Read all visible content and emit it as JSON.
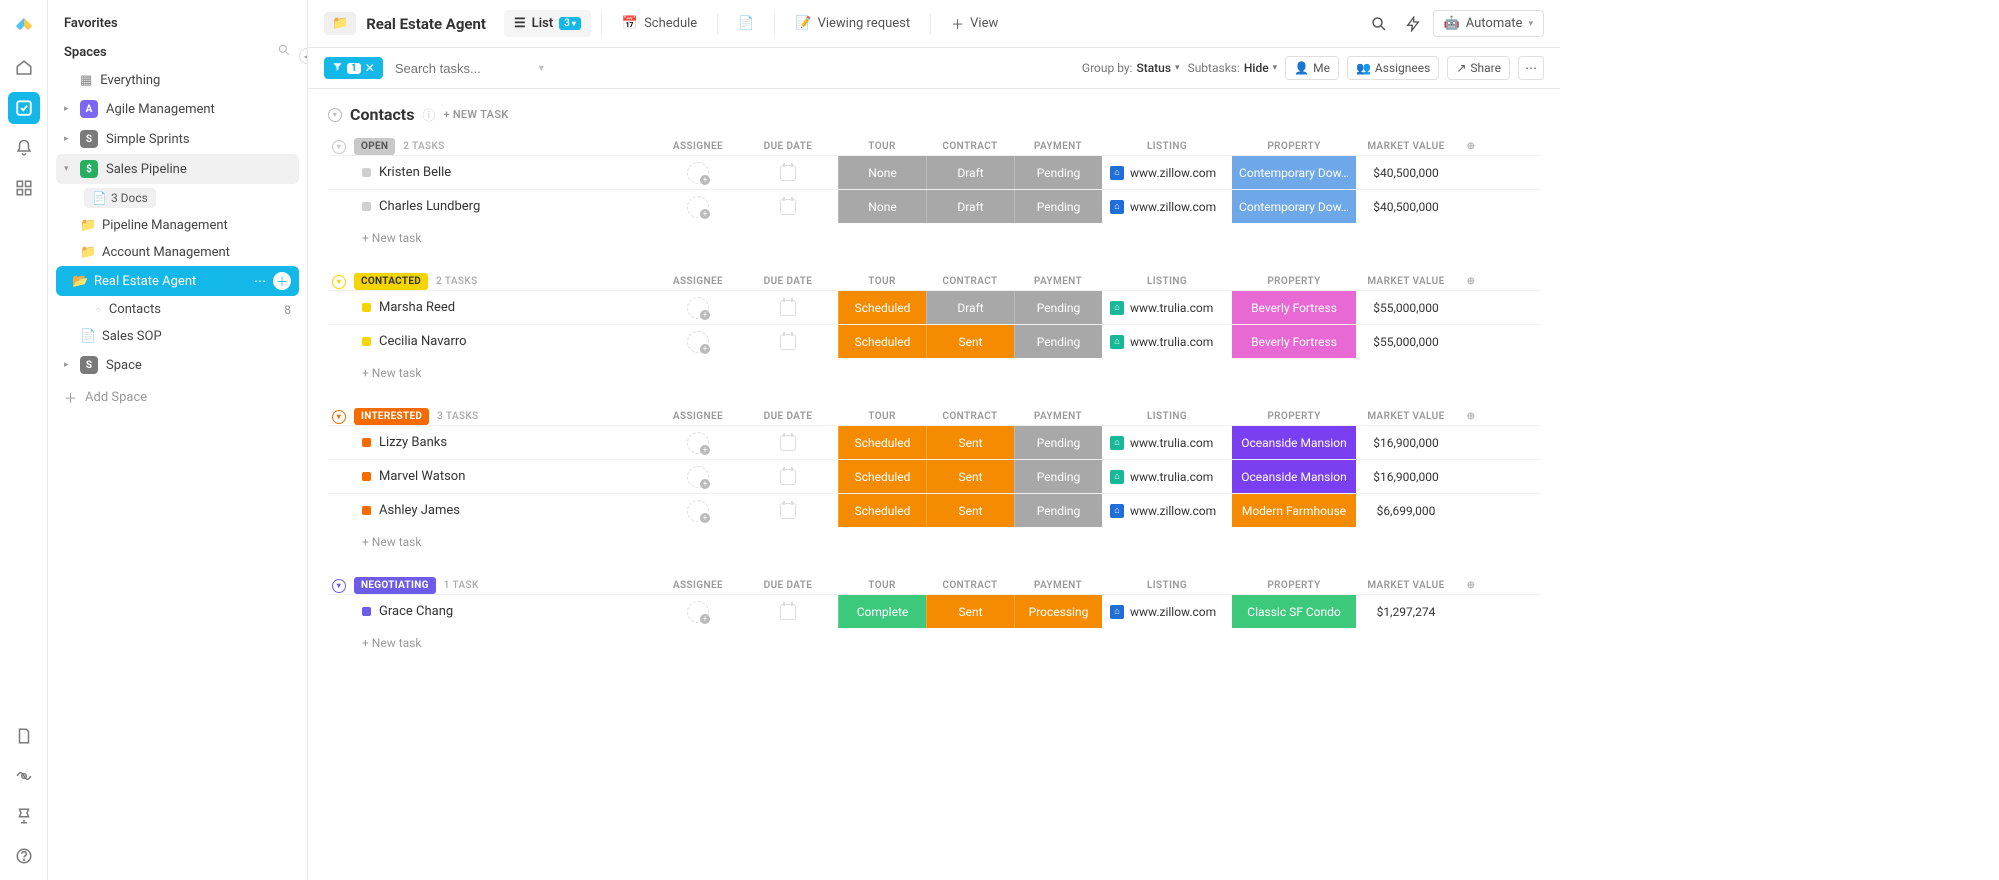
{
  "sidebar": {
    "favorites": "Favorites",
    "spaces": "Spaces",
    "everything": "Everything",
    "items": [
      {
        "label": "Agile Management",
        "badge": "A",
        "color": "purple"
      },
      {
        "label": "Simple Sprints",
        "badge": "S",
        "color": "gray"
      },
      {
        "label": "Sales Pipeline",
        "badge": "$",
        "color": "green"
      }
    ],
    "docs_chip": "3 Docs",
    "folders": [
      {
        "label": "Pipeline Management"
      },
      {
        "label": "Account Management"
      }
    ],
    "active_folder": "Real Estate Agent",
    "active_list": {
      "label": "Contacts",
      "count": "8"
    },
    "sales_sop": "Sales SOP",
    "space_item": {
      "label": "Space",
      "badge": "S"
    },
    "add_space": "Add Space"
  },
  "topbar": {
    "title": "Real Estate Agent",
    "views": [
      {
        "label": "List",
        "count": "3",
        "icon": "list",
        "active": true
      },
      {
        "label": "Schedule",
        "icon": "calendar"
      },
      {
        "label": "",
        "icon": "doc"
      },
      {
        "label": "Viewing request",
        "icon": "form"
      },
      {
        "label": "View",
        "icon": "plus"
      }
    ],
    "automate": "Automate"
  },
  "toolbar": {
    "filter_count": "1",
    "search_placeholder": "Search tasks...",
    "group_by_label": "Group by:",
    "group_by_value": "Status",
    "subtasks_label": "Subtasks:",
    "subtasks_value": "Hide",
    "me": "Me",
    "assignees": "Assignees",
    "share": "Share"
  },
  "list": {
    "title": "Contacts",
    "new_task": "+ NEW TASK",
    "columns": {
      "assignee": "ASSIGNEE",
      "due": "DUE DATE",
      "tour": "TOUR",
      "contract": "CONTRACT",
      "payment": "PAYMENT",
      "listing": "LISTING",
      "property": "PROPERTY",
      "value": "MARKET VALUE"
    },
    "new_task_row": "+ New task",
    "groups": [
      {
        "status": "OPEN",
        "status_bg": "#c9c9c9",
        "status_fg": "#555",
        "chev": "#c9c9c9",
        "count": "2 TASKS",
        "dot": "#d0d0d0",
        "tasks": [
          {
            "name": "Kristen Belle",
            "tour": "None",
            "tour_bg": "#a8a8a8",
            "contract": "Draft",
            "contract_bg": "#a8a8a8",
            "payment": "Pending",
            "payment_bg": "#a8a8a8",
            "listing": "www.zillow.com",
            "listing_color": "#1e6fd9",
            "property": "Contemporary Dow…",
            "property_bg": "#6ea8e8",
            "value": "$40,500,000"
          },
          {
            "name": "Charles Lundberg",
            "tour": "None",
            "tour_bg": "#a8a8a8",
            "contract": "Draft",
            "contract_bg": "#a8a8a8",
            "payment": "Pending",
            "payment_bg": "#a8a8a8",
            "listing": "www.zillow.com",
            "listing_color": "#1e6fd9",
            "property": "Contemporary Dow…",
            "property_bg": "#6ea8e8",
            "value": "$40,500,000"
          }
        ]
      },
      {
        "status": "CONTACTED",
        "status_bg": "#f5d500",
        "status_fg": "#333",
        "chev": "#f5d500",
        "count": "2 TASKS",
        "dot": "#f5d500",
        "tasks": [
          {
            "name": "Marsha Reed",
            "tour": "Scheduled",
            "tour_bg": "#f58b00",
            "contract": "Draft",
            "contract_bg": "#a8a8a8",
            "payment": "Pending",
            "payment_bg": "#a8a8a8",
            "listing": "www.trulia.com",
            "listing_color": "#17b897",
            "property": "Beverly Fortress",
            "property_bg": "#e868d4",
            "value": "$55,000,000"
          },
          {
            "name": "Cecilia Navarro",
            "tour": "Scheduled",
            "tour_bg": "#f58b00",
            "contract": "Sent",
            "contract_bg": "#f58b00",
            "payment": "Pending",
            "payment_bg": "#a8a8a8",
            "listing": "www.trulia.com",
            "listing_color": "#17b897",
            "property": "Beverly Fortress",
            "property_bg": "#e868d4",
            "value": "$55,000,000"
          }
        ]
      },
      {
        "status": "INTERESTED",
        "status_bg": "#f56b00",
        "status_fg": "#fff",
        "chev": "#f56b00",
        "count": "3 TASKS",
        "dot": "#f56b00",
        "tasks": [
          {
            "name": "Lizzy Banks",
            "tour": "Scheduled",
            "tour_bg": "#f58b00",
            "contract": "Sent",
            "contract_bg": "#f58b00",
            "payment": "Pending",
            "payment_bg": "#a8a8a8",
            "listing": "www.trulia.com",
            "listing_color": "#17b897",
            "property": "Oceanside Mansion",
            "property_bg": "#7b3ff2",
            "value": "$16,900,000"
          },
          {
            "name": "Marvel Watson",
            "tour": "Scheduled",
            "tour_bg": "#f58b00",
            "contract": "Sent",
            "contract_bg": "#f58b00",
            "payment": "Pending",
            "payment_bg": "#a8a8a8",
            "listing": "www.trulia.com",
            "listing_color": "#17b897",
            "property": "Oceanside Mansion",
            "property_bg": "#7b3ff2",
            "value": "$16,900,000"
          },
          {
            "name": "Ashley James",
            "tour": "Scheduled",
            "tour_bg": "#f58b00",
            "contract": "Sent",
            "contract_bg": "#f58b00",
            "payment": "Pending",
            "payment_bg": "#a8a8a8",
            "listing": "www.zillow.com",
            "listing_color": "#1e6fd9",
            "property": "Modern Farmhouse",
            "property_bg": "#f58b00",
            "value": "$6,699,000"
          }
        ]
      },
      {
        "status": "NEGOTIATING",
        "status_bg": "#6c5ce7",
        "status_fg": "#fff",
        "chev": "#6c5ce7",
        "count": "1 TASK",
        "dot": "#6c5ce7",
        "tasks": [
          {
            "name": "Grace Chang",
            "tour": "Complete",
            "tour_bg": "#3cc97b",
            "contract": "Sent",
            "contract_bg": "#f58b00",
            "payment": "Processing",
            "payment_bg": "#f58b00",
            "listing": "www.zillow.com",
            "listing_color": "#1e6fd9",
            "property": "Classic SF Condo",
            "property_bg": "#3cc97b",
            "value": "$1,297,274"
          }
        ]
      }
    ]
  }
}
